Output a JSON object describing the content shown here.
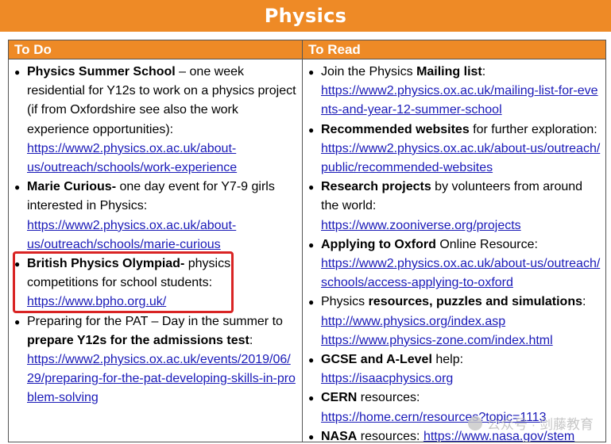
{
  "title": "Physics",
  "headers": {
    "todo": "To Do",
    "toread": "To Read"
  },
  "todo": [
    {
      "bold": "Physics Summer School",
      "text": " – one week residential for Y12s to work on a physics project (if from Oxfordshire see also the work experience opportunities):",
      "link": "https://www2.physics.ox.ac.uk/about-us/outreach/schools/work-experience"
    },
    {
      "bold": "Marie Curious-",
      "text": " one day event for Y7-9 girls interested in Physics:",
      "link": "https://www2.physics.ox.ac.uk/about-us/outreach/schools/marie-curious"
    },
    {
      "bold": "British Physics Olympiad-",
      "text": " physics competitions for school students:",
      "link": "https://www.bpho.org.uk/"
    },
    {
      "pre": "Preparing for the PAT – Day in the summer to ",
      "bold": "prepare Y12s for the admissions test",
      "text": ":",
      "link": "https://www2.physics.ox.ac.uk/events/2019/06/29/preparing-for-the-pat-developing-skills-in-problem-solving"
    }
  ],
  "toread": [
    {
      "pre": "Join the Physics ",
      "bold": "Mailing list",
      "text": ":",
      "link": "https://www2.physics.ox.ac.uk/mailing-list-for-events-and-year-12-summer-school"
    },
    {
      "bold": "Recommended websites",
      "text": " for further exploration:",
      "link": "https://www2.physics.ox.ac.uk/about-us/outreach/public/recommended-websites"
    },
    {
      "bold": "Research projects",
      "text": " by volunteers from around the world:",
      "link": "https://www.zooniverse.org/projects"
    },
    {
      "bold": "Applying to Oxford",
      "text": " Online Resource:",
      "link": "https://www2.physics.ox.ac.uk/about-us/outreach/schools/access-applying-to-oxford"
    },
    {
      "pre": "Physics ",
      "bold": "resources, puzzles and simulations",
      "text": ":",
      "link": "http://www.physics.org/index.asp",
      "link2": "https://www.physics-zone.com/index.html"
    },
    {
      "bold": "GCSE and A-Level",
      "text": " help:",
      "link": "https://isaacphysics.org"
    },
    {
      "bold": "CERN",
      "text": " resources:",
      "link": "https://home.cern/resources?topic=1113"
    },
    {
      "bold": "NASA",
      "text": " resources: ",
      "inline_link": "https://www.nasa.gov/stem"
    }
  ],
  "watermark": "公众号 · 剑藤教育"
}
